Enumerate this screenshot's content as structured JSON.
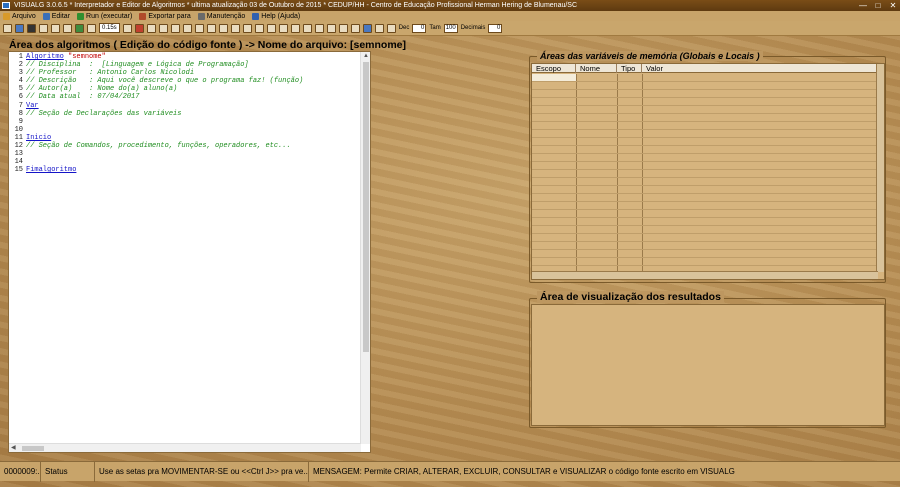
{
  "window": {
    "title": "VISUALG 3.0.6.5 * Interpretador e Editor de Algoritmos * ultima atualização 03 de Outubro de 2015 * CEDUP/HH - Centro de Educação Profissional Herman Hering de Blumenau/SC",
    "minimize": "—",
    "maximize": "□",
    "close": "✕"
  },
  "menu": [
    {
      "label": "Arquivo",
      "icon": "folder-icon",
      "color": "#d89a2a"
    },
    {
      "label": "Editar",
      "icon": "edit-icon",
      "color": "#3a6fb8"
    },
    {
      "label": "Run (executar)",
      "icon": "run-icon",
      "color": "#2f8f2f"
    },
    {
      "label": "Exportar para",
      "icon": "export-icon",
      "color": "#b04a2a"
    },
    {
      "label": "Manutenção",
      "icon": "tools-icon",
      "color": "#6a6a6a"
    },
    {
      "label": "Help (Ajuda)",
      "icon": "help-icon",
      "color": "#3060b0"
    }
  ],
  "toolbar": {
    "speed": "0.15s",
    "dec_label": "Dec",
    "dec_value": "0",
    "tam_label": "Tam",
    "tam_value": "100",
    "decimais_label": "Decimais",
    "decimais_value": "0"
  },
  "editor": {
    "title": "Área dos algoritmos ( Edição do código fonte ) -> Nome do arquivo: [semnome]",
    "lines": [
      {
        "n": "1",
        "kw": "Algoritmo",
        "str": " \"semnome\"",
        "cm": ""
      },
      {
        "n": "2",
        "kw": "",
        "str": "",
        "cm": "// Disciplina  :  [Linguagem e Lógica de Programação]"
      },
      {
        "n": "3",
        "kw": "",
        "str": "",
        "cm": "// Professor   : Antonio Carlos Nicolodi"
      },
      {
        "n": "4",
        "kw": "",
        "str": "",
        "cm": "// Descrição   : Aqui você descreve o que o programa faz! (função)"
      },
      {
        "n": "5",
        "kw": "",
        "str": "",
        "cm": "// Autor(a)    : Nome do(a) aluno(a)"
      },
      {
        "n": "6",
        "kw": "",
        "str": "",
        "cm": "// Data atual  : 07/04/2017"
      },
      {
        "n": "7",
        "kw": "Var",
        "str": "",
        "cm": ""
      },
      {
        "n": "8",
        "kw": "",
        "str": "",
        "cm": "// Seção de Declarações das variáveis"
      },
      {
        "n": "9",
        "kw": "",
        "str": "",
        "cm": ""
      },
      {
        "n": "10",
        "kw": "",
        "str": "",
        "cm": ""
      },
      {
        "n": "11",
        "kw": "Inicio",
        "str": "",
        "cm": ""
      },
      {
        "n": "12",
        "kw": "",
        "str": "",
        "cm": "// Seção de Comandos, procedimento, funções, operadores, etc..."
      },
      {
        "n": "13",
        "kw": "",
        "str": "",
        "cm": ""
      },
      {
        "n": "14",
        "kw": "",
        "str": "",
        "cm": ""
      },
      {
        "n": "15",
        "kw": "Fimalgoritmo",
        "str": "",
        "cm": ""
      }
    ]
  },
  "vars": {
    "title": "Áreas das variáveis de memória (Globais e Locais )",
    "columns": [
      "Escopo",
      "Nome",
      "Tipo",
      "Valor"
    ]
  },
  "results": {
    "title": "Área de visualização dos resultados"
  },
  "status": [
    "0000009:...",
    "Status",
    "Use as setas pra MOVIMENTAR-SE ou <<Ctrl J>> pra ve...",
    "MENSAGEM: Permite CRIAR, ALTERAR, EXCLUIR, CONSULTAR e VISUALIZAR o código fonte escrito em VISUALG"
  ]
}
